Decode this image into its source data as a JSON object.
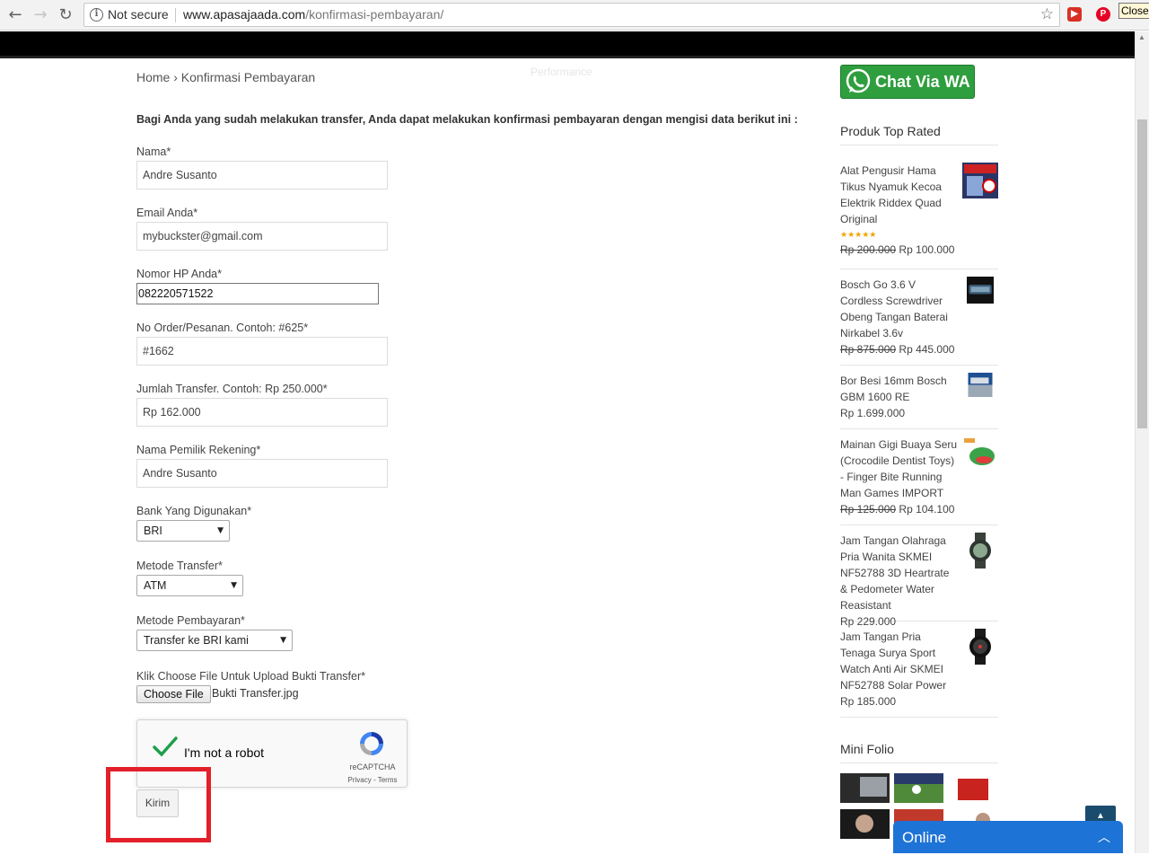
{
  "browser": {
    "security_label": "Not secure",
    "url_host": "www.apasajaada.com",
    "url_path": "/konfirmasi-pembayaran/",
    "tooltip": "Close"
  },
  "page": {
    "faint_text": "Performance",
    "breadcrumb": "Home › Konfirmasi Pembayaran",
    "intro": "Bagi Anda yang sudah melakukan transfer, Anda dapat melakukan konfirmasi pembayaran dengan mengisi data berikut ini :"
  },
  "form": {
    "nama_label": "Nama*",
    "nama_value": "Andre Susanto",
    "email_label": "Email Anda*",
    "email_value": "mybuckster@gmail.com",
    "hp_label": "Nomor HP Anda*",
    "hp_value": "082220571522",
    "order_label": "No Order/Pesanan. Contoh: #625*",
    "order_value": "#1662",
    "jumlah_label": "Jumlah Transfer. Contoh: Rp 250.000*",
    "jumlah_value": "Rp 162.000",
    "pemilik_label": "Nama Pemilik Rekening*",
    "pemilik_value": "Andre Susanto",
    "bank_label": "Bank Yang Digunakan*",
    "bank_value": "BRI",
    "metode_transfer_label": "Metode Transfer*",
    "metode_transfer_value": "ATM",
    "metode_bayar_label": "Metode Pembayaran*",
    "metode_bayar_value": "Transfer ke BRI kami",
    "upload_label": "Klik Choose File Untuk Upload Bukti Transfer*",
    "choose_file": "Choose File",
    "file_name": "Bukti Transfer.jpg",
    "captcha_label": "I'm not a robot",
    "captcha_brand": "reCAPTCHA",
    "captcha_terms": "Privacy - Terms",
    "submit": "Kirim"
  },
  "sidebar": {
    "wa_button": "Chat Via WA",
    "top_rated_heading": "Produk Top Rated",
    "products": [
      {
        "name": "Alat Pengusir Hama Tikus Nyamuk Kecoa Elektrik Riddex Quad Original",
        "rating": 5,
        "old_price": "Rp 200.000",
        "price": "Rp 100.000"
      },
      {
        "name": "Bosch Go 3.6 V Cordless Screwdriver Obeng Tangan Baterai Nirkabel 3.6v",
        "old_price": "Rp 875.000",
        "price": "Rp 445.000"
      },
      {
        "name": "Bor Besi 16mm Bosch GBM 1600 RE",
        "old_price": "",
        "price": "Rp 1.699.000"
      },
      {
        "name": "Mainan Gigi Buaya Seru (Crocodile Dentist Toys) - Finger Bite Running Man Games IMPORT",
        "old_price": "Rp 125.000",
        "price": "Rp 104.100"
      },
      {
        "name": "Jam Tangan Olahraga Pria Wanita SKMEI NF52788 3D Heartrate & Pedometer Water Reasistant",
        "old_price": "",
        "price": "Rp 229.000"
      },
      {
        "name": "Jam Tangan Pria Tenaga Surya Sport Watch Anti Air SKMEI NF52788 Solar Power",
        "old_price": "",
        "price": "Rp 185.000"
      }
    ],
    "mini_folio_heading": "Mini Folio",
    "stars_glyph": "★★★★★"
  },
  "chat": {
    "label": "Online"
  },
  "colors": {
    "whatsapp_green": "#2f9e3e",
    "chat_blue": "#1e73d6",
    "highlight_red": "#e3202a"
  }
}
